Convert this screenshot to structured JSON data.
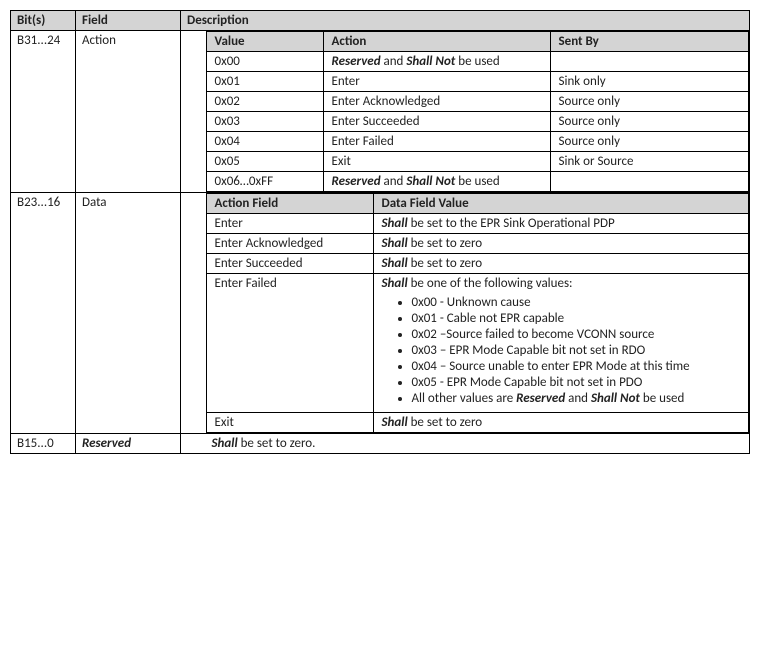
{
  "headers": {
    "bits": "Bit(s)",
    "field": "Field",
    "description": "Description"
  },
  "rows": {
    "action": {
      "bits": "B31...24",
      "field": "Action",
      "table": {
        "headers": {
          "value": "Value",
          "action": "Action",
          "sentby": "Sent By"
        },
        "rows": [
          {
            "value": "0x00",
            "action_pre": "Reserved",
            "action_mid": " and ",
            "action_post": "Shall Not",
            "action_suffix": " be used",
            "sentby": ""
          },
          {
            "value": "0x01",
            "action": "Enter",
            "sentby": "Sink only"
          },
          {
            "value": "0x02",
            "action": "Enter Acknowledged",
            "sentby": "Source only"
          },
          {
            "value": "0x03",
            "action": "Enter Succeeded",
            "sentby": "Source only"
          },
          {
            "value": "0x04",
            "action": "Enter Failed",
            "sentby": "Source only"
          },
          {
            "value": "0x05",
            "action": "Exit",
            "sentby": "Sink or Source"
          },
          {
            "value": "0x06…0xFF",
            "action_pre": "Reserved",
            "action_mid": " and ",
            "action_post": "Shall Not",
            "action_suffix": " be used",
            "sentby": ""
          }
        ]
      }
    },
    "data": {
      "bits": "B23...16",
      "field": "Data",
      "table": {
        "headers": {
          "actionfield": "Action Field",
          "datafield": "Data Field Value"
        },
        "rows": {
          "enter": {
            "af": "Enter",
            "pre": "Shall",
            "rest": " be set to the EPR Sink Operational PDP"
          },
          "enter_ack": {
            "af": "Enter Acknowledged",
            "pre": "Shall",
            "rest": " be set to zero"
          },
          "enter_succ": {
            "af": "Enter Succeeded",
            "pre": "Shall",
            "rest": " be set to zero"
          },
          "enter_fail": {
            "af": "Enter Failed",
            "pre": "Shall",
            "rest": " be one of the following values:",
            "items": {
              "i0": "0x00 - Unknown cause",
              "i1": "0x01 - Cable not EPR capable",
              "i2a": "0x02 –Source failed to become V",
              "i2b": "CONN",
              "i2c": " source",
              "i3": "0x03 – EPR Mode Capable bit not set in RDO",
              "i4": "0x04 – Source unable to enter EPR Mode at this time",
              "i5": "0x05 - EPR Mode Capable bit not set in PDO",
              "i6a": "All other values are ",
              "i6b": "Reserved",
              "i6c": " and ",
              "i6d": "Shall Not",
              "i6e": " be used"
            }
          },
          "exit": {
            "af": "Exit",
            "pre": "Shall",
            "rest": " be set to zero"
          }
        }
      }
    },
    "reserved": {
      "bits": "B15...0",
      "field": "Reserved",
      "pre": "Shall",
      "rest": " be set to zero."
    }
  }
}
